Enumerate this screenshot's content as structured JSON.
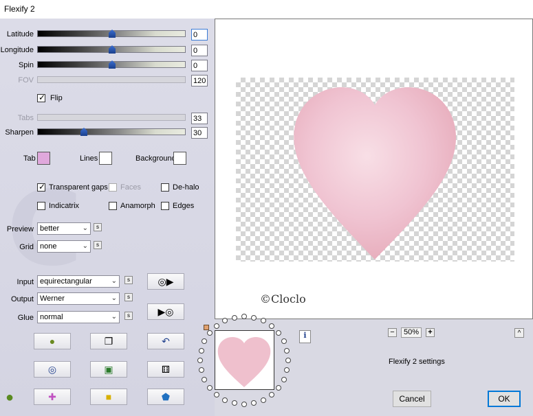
{
  "window": {
    "title": "Flexify 2"
  },
  "sliders": [
    {
      "id": "latitude",
      "label": "Latitude",
      "value": "0",
      "fraction": 0.5,
      "enabled": true,
      "focused": true
    },
    {
      "id": "longitude",
      "label": "Longitude",
      "value": "0",
      "fraction": 0.5,
      "enabled": true,
      "focused": false
    },
    {
      "id": "spin",
      "label": "Spin",
      "value": "0",
      "fraction": 0.5,
      "enabled": true,
      "focused": false
    },
    {
      "id": "fov",
      "label": "FOV",
      "value": "120",
      "fraction": 0.0,
      "enabled": false,
      "focused": false
    },
    {
      "id": "tabs",
      "label": "Tabs",
      "value": "33",
      "fraction": 0.0,
      "enabled": false,
      "focused": false
    },
    {
      "id": "sharpen",
      "label": "Sharpen",
      "value": "30",
      "fraction": 0.3,
      "enabled": true,
      "focused": false
    }
  ],
  "flip": {
    "label": "Flip",
    "checked": true
  },
  "colors": {
    "tab_label": "Tab",
    "tab_color": "#e0a8dc",
    "lines_label": "Lines",
    "lines_color": "#ffffff",
    "background_label": "Background",
    "background_color": "#ffffff"
  },
  "options": {
    "transparent_gaps": {
      "label": "Transparent gaps",
      "checked": true
    },
    "faces": {
      "label": "Faces",
      "checked": false,
      "enabled": false
    },
    "dehalo": {
      "label": "De-halo",
      "checked": false
    },
    "indicatrix": {
      "label": "Indicatrix",
      "checked": false
    },
    "anamorph": {
      "label": "Anamorph",
      "checked": false
    },
    "edges": {
      "label": "Edges",
      "checked": false
    }
  },
  "preview": {
    "label": "Preview",
    "value": "better",
    "s": "s"
  },
  "grid": {
    "label": "Grid",
    "value": "none",
    "s": "s"
  },
  "input": {
    "label": "Input",
    "value": "equirectangular",
    "s": "s"
  },
  "output": {
    "label": "Output",
    "value": "Werner",
    "s": "s"
  },
  "glue": {
    "label": "Glue",
    "value": "normal",
    "s": "s"
  },
  "icons": {
    "record": "record-icon",
    "play": "play-icon",
    "globe": "globe-icon",
    "copy": "copy-icon",
    "undo": "undo-icon",
    "ring": "ring-icon",
    "frame": "frame-icon",
    "dice": "dice-icon",
    "apple": "apple-icon",
    "cross": "cross-shape-icon",
    "cube": "cube-icon",
    "pentagon": "pentagon-icon",
    "info": "i"
  },
  "watermark": {
    "text": "©Cloclo"
  },
  "zoom": {
    "minus": "−",
    "value": "50%",
    "plus": "+"
  },
  "collapse": "^",
  "status": "Flexify 2 settings",
  "buttons": {
    "cancel": "Cancel",
    "ok": "OK"
  }
}
